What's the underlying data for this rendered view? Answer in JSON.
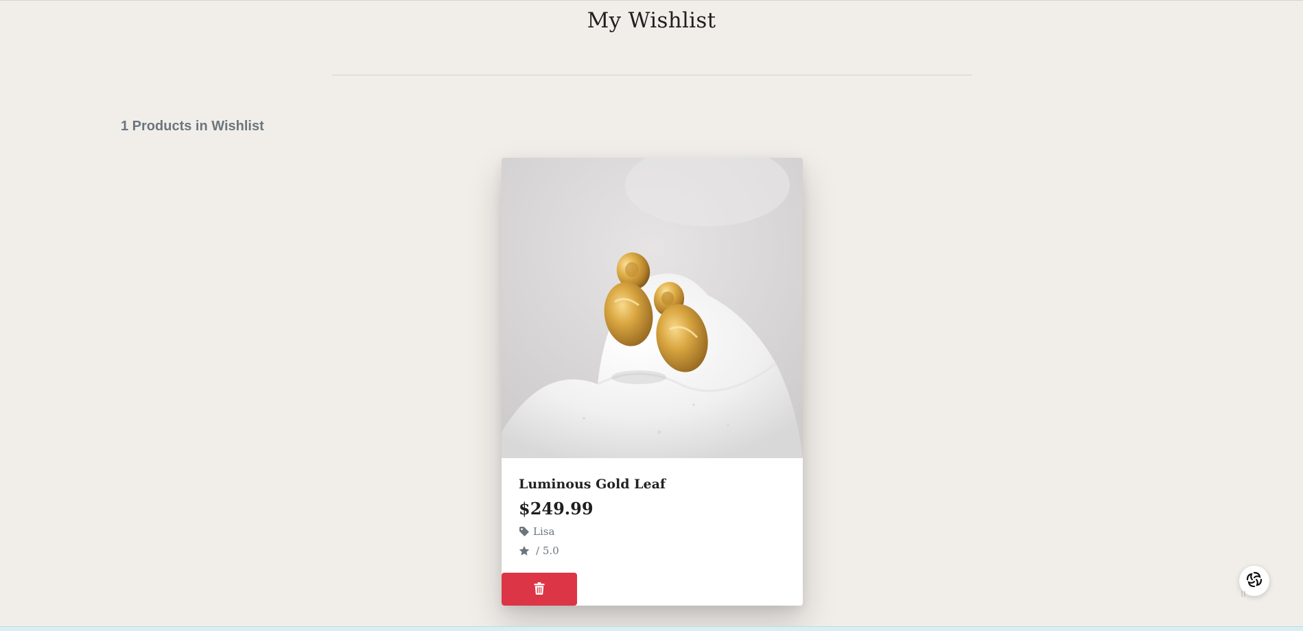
{
  "page": {
    "title": "My Wishlist"
  },
  "wishlist": {
    "count_label": "1 Products in Wishlist",
    "items": [
      {
        "name": "Luminous Gold Leaf",
        "price": "$249.99",
        "brand": "Lisa",
        "rating": "/ 5.0",
        "image": "gold-leaf-earrings-photo"
      }
    ]
  },
  "icons": {
    "brand": "tag-icon",
    "rating": "star-icon",
    "delete": "trash-icon",
    "chat": "chat-widget-icon"
  },
  "colors": {
    "background": "#f1eeea",
    "delete_button": "#dc3545",
    "muted_text": "#6c757d"
  }
}
